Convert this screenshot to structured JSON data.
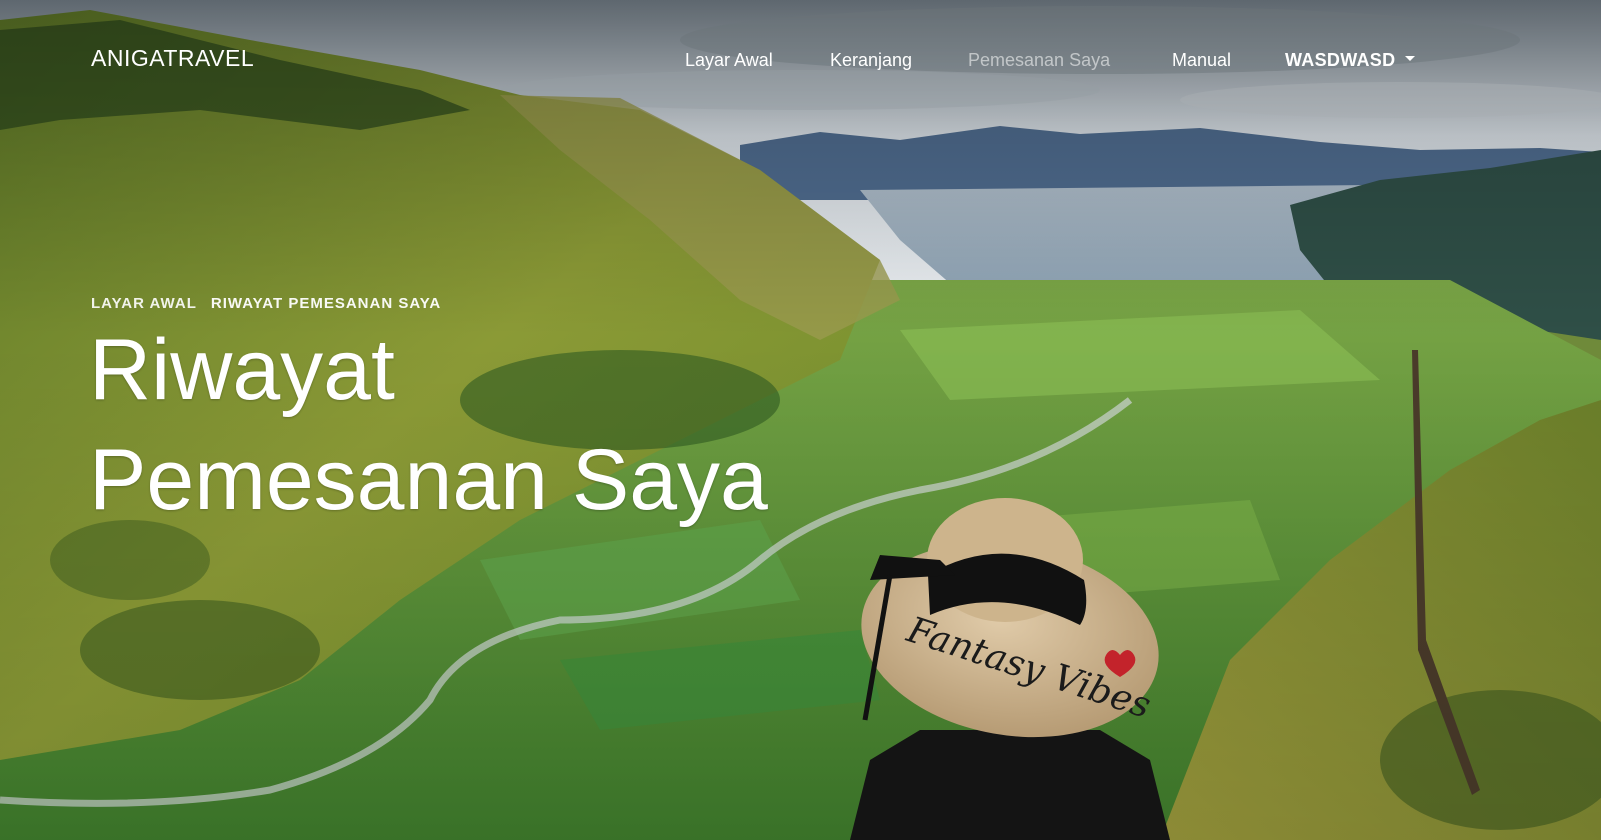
{
  "navbar": {
    "brand": "ANIGATRAVEL",
    "links": [
      {
        "label": "Layar Awal",
        "active": false
      },
      {
        "label": "Keranjang",
        "active": false
      },
      {
        "label": "Pemesanan Saya",
        "active": true
      },
      {
        "label": "Manual",
        "active": false
      }
    ],
    "user_menu_label": "WASDWASD"
  },
  "breadcrumb": {
    "home": "LAYAR AWAL",
    "current": "RIWAYAT PEMESANAN SAYA"
  },
  "hero": {
    "title_line1": "Riwayat",
    "title_line2": "Pemesanan Saya",
    "hat_text": "Fantasy Vibes"
  },
  "colors": {
    "text": "#ffffff",
    "active_link": "rgba(255,255,255,0.55)",
    "sky": "#dfe5ea",
    "lake": "#9aaebf",
    "hills": "#7c8f2e",
    "valley": "#5e9a3a"
  },
  "icons": {
    "user_menu_caret": "caret-down-icon"
  }
}
